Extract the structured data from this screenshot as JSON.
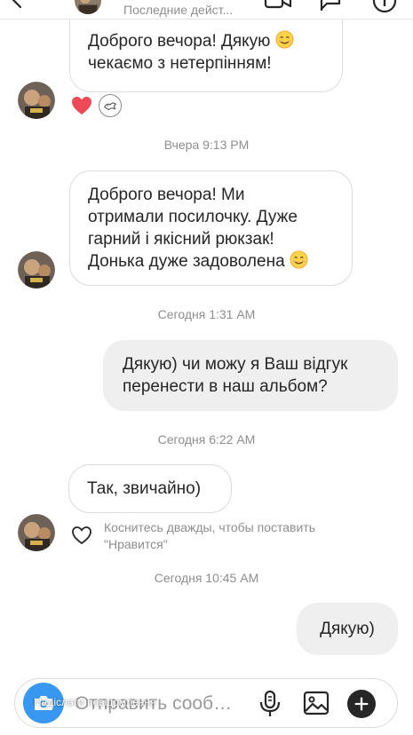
{
  "header": {
    "status": "Последние дейст...",
    "icons": [
      "back-arrow-icon",
      "video-camera-icon",
      "flag-icon",
      "info-icon"
    ]
  },
  "messages": [
    {
      "direction": "incoming",
      "line1": "Доброго вечора! Дякую",
      "line2": "чекаємо з нетерпінням!",
      "emoji": "smiling-face-icon"
    },
    {
      "direction": "incoming",
      "line1": "Доброго вечора! Ми",
      "line2": "отримали посилочку. Дуже",
      "line3": "гарний і якісний рюкзак!",
      "line4": "Донька дуже задоволена",
      "emoji": "smiling-face-icon"
    },
    {
      "direction": "outgoing",
      "line1": "Дякую) чи можу я Ваш відгук",
      "line2": "перенести в наш альбом?"
    },
    {
      "direction": "incoming",
      "line1": "Так, звичайно)"
    },
    {
      "direction": "outgoing",
      "line1": "Дякую)"
    }
  ],
  "timestamps": [
    "Вчера 9:13 PM",
    "Сегодня 1:31 AM",
    "Сегодня 6:22 AM",
    "Сегодня 10:45 AM"
  ],
  "reactions": {
    "heart_color": "#ed4956",
    "icons": [
      "heart-icon",
      "sticker-icon"
    ]
  },
  "like_hint": {
    "line1": "Коснитесь дважды, чтобы поставить",
    "line2": "\"Нравится\""
  },
  "composer": {
    "placeholder": "Отправить сообщ...",
    "overlay_label": "Надіслати повідомлення",
    "camera_color": "#3897f0",
    "icons": [
      "camera-icon",
      "microphone-icon",
      "image-icon",
      "plus-icon"
    ]
  }
}
